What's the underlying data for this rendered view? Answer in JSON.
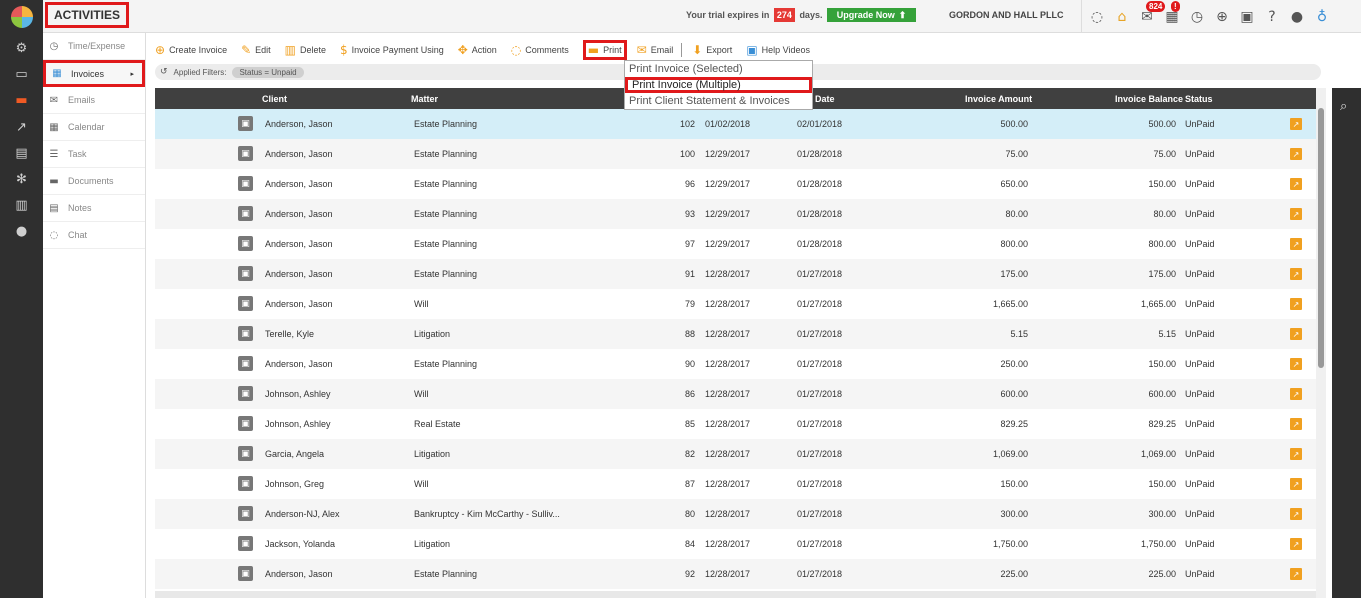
{
  "rail": {
    "items": [
      {
        "icon": "dashboard-icon",
        "glyph": "⚙"
      },
      {
        "icon": "folder-icon",
        "glyph": "▭"
      },
      {
        "icon": "laptop-icon",
        "glyph": "▬"
      },
      {
        "icon": "chart-line-icon",
        "glyph": "↗"
      },
      {
        "icon": "book-icon",
        "glyph": "▤"
      },
      {
        "icon": "cogs-icon",
        "glyph": "✻"
      },
      {
        "icon": "bar-chart-icon",
        "glyph": "▥"
      },
      {
        "icon": "user-icon",
        "glyph": "●"
      }
    ]
  },
  "header": {
    "title": "ACTIVITIES",
    "trial_prefix": "Your trial expires in",
    "trial_days": "274",
    "trial_suffix": "days.",
    "upgrade_label": "Upgrade Now",
    "firm_name": "GORDON AND HALL PLLC",
    "mail_badge": "824",
    "calendar_badge": "!"
  },
  "sidemenu": {
    "items": [
      {
        "label": "Time/Expense",
        "icon": "clock-icon"
      },
      {
        "label": "Invoices",
        "icon": "invoice-icon"
      },
      {
        "label": "Emails",
        "icon": "envelope-icon"
      },
      {
        "label": "Calendar",
        "icon": "calendar-icon"
      },
      {
        "label": "Task",
        "icon": "task-icon"
      },
      {
        "label": "Documents",
        "icon": "folder-icon"
      },
      {
        "label": "Notes",
        "icon": "notes-icon"
      },
      {
        "label": "Chat",
        "icon": "chat-icon"
      }
    ]
  },
  "toolbar": {
    "create_invoice": "Create Invoice",
    "edit": "Edit",
    "delete": "Delete",
    "invoice_payment": "Invoice Payment Using",
    "action": "Action",
    "comments": "Comments",
    "print": "Print",
    "email": "Email",
    "export": "Export",
    "help_videos": "Help Videos"
  },
  "filters": {
    "label": "Applied Filters:",
    "chip": "Status = Unpaid"
  },
  "print_menu": {
    "items": [
      "Print Invoice (Selected)",
      "Print Invoice (Multiple)",
      "Print Client Statement & Invoices"
    ]
  },
  "table": {
    "headers": {
      "client": "Client",
      "matter": "Matter",
      "due_date": "Date",
      "amount": "Invoice Amount",
      "balance": "Invoice Balance",
      "status": "Status"
    },
    "rows": [
      {
        "client": "Anderson, Jason",
        "matter": "Estate Planning",
        "no": "102",
        "date": "01/02/2018",
        "due": "02/01/2018",
        "amount": "500.00",
        "balance": "500.00",
        "status": "UnPaid"
      },
      {
        "client": "Anderson, Jason",
        "matter": "Estate Planning",
        "no": "100",
        "date": "12/29/2017",
        "due": "01/28/2018",
        "amount": "75.00",
        "balance": "75.00",
        "status": "UnPaid"
      },
      {
        "client": "Anderson, Jason",
        "matter": "Estate Planning",
        "no": "96",
        "date": "12/29/2017",
        "due": "01/28/2018",
        "amount": "650.00",
        "balance": "150.00",
        "status": "UnPaid"
      },
      {
        "client": "Anderson, Jason",
        "matter": "Estate Planning",
        "no": "93",
        "date": "12/29/2017",
        "due": "01/28/2018",
        "amount": "80.00",
        "balance": "80.00",
        "status": "UnPaid"
      },
      {
        "client": "Anderson, Jason",
        "matter": "Estate Planning",
        "no": "97",
        "date": "12/29/2017",
        "due": "01/28/2018",
        "amount": "800.00",
        "balance": "800.00",
        "status": "UnPaid"
      },
      {
        "client": "Anderson, Jason",
        "matter": "Estate Planning",
        "no": "91",
        "date": "12/28/2017",
        "due": "01/27/2018",
        "amount": "175.00",
        "balance": "175.00",
        "status": "UnPaid"
      },
      {
        "client": "Anderson, Jason",
        "matter": "Will",
        "no": "79",
        "date": "12/28/2017",
        "due": "01/27/2018",
        "amount": "1,665.00",
        "balance": "1,665.00",
        "status": "UnPaid"
      },
      {
        "client": "Terelle, Kyle",
        "matter": "Litigation",
        "no": "88",
        "date": "12/28/2017",
        "due": "01/27/2018",
        "amount": "5.15",
        "balance": "5.15",
        "status": "UnPaid"
      },
      {
        "client": "Anderson, Jason",
        "matter": "Estate Planning",
        "no": "90",
        "date": "12/28/2017",
        "due": "01/27/2018",
        "amount": "250.00",
        "balance": "150.00",
        "status": "UnPaid"
      },
      {
        "client": "Johnson, Ashley",
        "matter": "Will",
        "no": "86",
        "date": "12/28/2017",
        "due": "01/27/2018",
        "amount": "600.00",
        "balance": "600.00",
        "status": "UnPaid"
      },
      {
        "client": "Johnson, Ashley",
        "matter": "Real Estate",
        "no": "85",
        "date": "12/28/2017",
        "due": "01/27/2018",
        "amount": "829.25",
        "balance": "829.25",
        "status": "UnPaid"
      },
      {
        "client": "Garcia, Angela",
        "matter": "Litigation",
        "no": "82",
        "date": "12/28/2017",
        "due": "01/27/2018",
        "amount": "1,069.00",
        "balance": "1,069.00",
        "status": "UnPaid"
      },
      {
        "client": "Johnson, Greg",
        "matter": "Will",
        "no": "87",
        "date": "12/28/2017",
        "due": "01/27/2018",
        "amount": "150.00",
        "balance": "150.00",
        "status": "UnPaid"
      },
      {
        "client": "Anderson-NJ, Alex",
        "matter": "Bankruptcy - Kim McCarthy - Sulliv...",
        "no": "80",
        "date": "12/28/2017",
        "due": "01/27/2018",
        "amount": "300.00",
        "balance": "300.00",
        "status": "UnPaid"
      },
      {
        "client": "Jackson, Yolanda",
        "matter": "Litigation",
        "no": "84",
        "date": "12/28/2017",
        "due": "01/27/2018",
        "amount": "1,750.00",
        "balance": "1,750.00",
        "status": "UnPaid"
      },
      {
        "client": "Anderson, Jason",
        "matter": "Estate Planning",
        "no": "92",
        "date": "12/28/2017",
        "due": "01/27/2018",
        "amount": "225.00",
        "balance": "225.00",
        "status": "UnPaid"
      }
    ]
  }
}
